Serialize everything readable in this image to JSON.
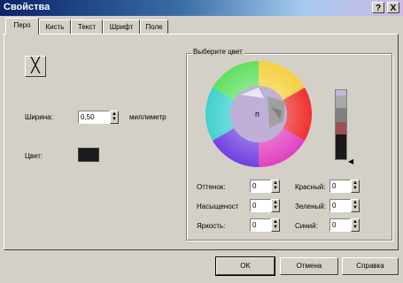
{
  "window": {
    "title": "Свойства",
    "help_glyph": "?",
    "close_glyph": "X"
  },
  "tabs": [
    {
      "label": "Перо",
      "active": true
    },
    {
      "label": "Кисть",
      "active": false
    },
    {
      "label": "Текст",
      "active": false
    },
    {
      "label": "Шрифт",
      "active": false
    },
    {
      "label": "Поле",
      "active": false
    }
  ],
  "pen": {
    "style_glyph": "╳",
    "width_label": "Ширина:",
    "width_value": "0,50",
    "width_unit": "миллиметр",
    "color_label": "Цвет:",
    "color_value": "#1a1a1a"
  },
  "color_picker": {
    "group_label": "Выберите цвет",
    "wheel_center_glyph": "п",
    "fields": [
      {
        "label": "Оттенок:",
        "value": "0"
      },
      {
        "label": "Насыщеност",
        "value": "0"
      },
      {
        "label": "Яркость:",
        "value": "0"
      },
      {
        "label": "Красный:",
        "value": "0"
      },
      {
        "label": "Зеленый:",
        "value": "0"
      },
      {
        "label": "Синий:",
        "value": "0"
      }
    ],
    "swatches": [
      "#c8b4e0",
      "#a8a8a8",
      "#808080",
      "#a05050",
      "#1a1a1a"
    ]
  },
  "buttons": {
    "ok": "OK",
    "cancel": "Отмена",
    "help": "Справка"
  }
}
